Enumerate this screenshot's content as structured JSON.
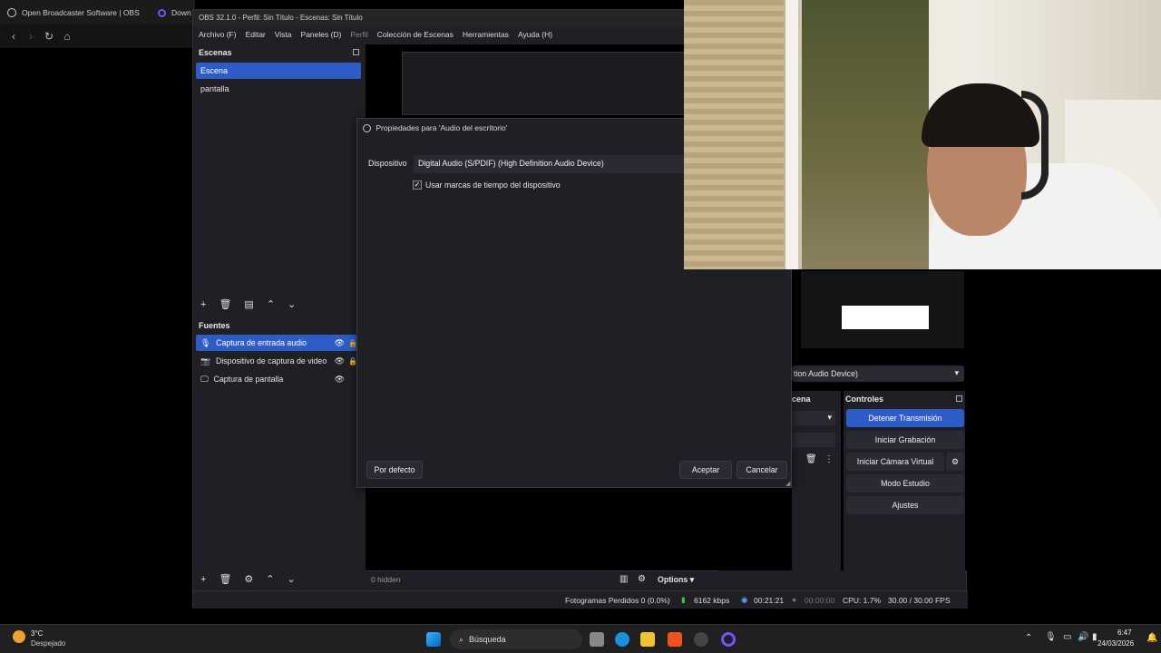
{
  "browser": {
    "tab1": "Open Broadcaster Software | OBS",
    "tab2": "Down"
  },
  "obs": {
    "title": "OBS 32.1.0 - Perfil: Sin Título - Escenas: Sin Título",
    "menu": [
      "Archivo (F)",
      "Editar",
      "Vista",
      "Paneles (D)",
      "Perfil",
      "Colección de Escenas",
      "Herramientas",
      "Ayuda (H)"
    ],
    "scenes_title": "Escenas",
    "scenes": [
      "Escena",
      "pantalla"
    ],
    "sources_title": "Fuentes",
    "sources": [
      "Captura de entrada audio",
      "Dispositivo de captura de video",
      "Captura de pantalla"
    ],
    "hidden_label": "0 hidden",
    "options_label": "Options",
    "device_partial": "tion Audio Device)",
    "scene_partial": "cena",
    "controls_title": "Controles",
    "controls": [
      "Detener Transmisión",
      "Iniciar Grabación",
      "Iniciar Cámara Virtual",
      "Modo Estudio",
      "Ajustes"
    ],
    "status": {
      "dropped": "Fotogramas Perdidos 0 (0.0%)",
      "bitrate": "6162 kbps",
      "stream_time": "00:21:21",
      "rec_time": "00:00:00",
      "cpu": "CPU: 1.7%",
      "fps": "30.00 / 30.00 FPS"
    }
  },
  "dialog": {
    "title": "Propiedades para 'Audio del escritorio'",
    "device_label": "Dispositivo",
    "device_value": "Digital Audio (S/PDIF) (High Definition Audio Device)",
    "checkbox_label": "Usar marcas de tiempo del dispositivo",
    "checkbox_checked": true,
    "default_button": "Por defecto",
    "accept_button": "Aceptar",
    "cancel_button": "Cancelar"
  },
  "taskbar": {
    "weather_temp": "3°C",
    "weather_desc": "Despejado",
    "search_placeholder": "Búsqueda",
    "time": "6:47",
    "date": "24/03/2026"
  },
  "colors": {
    "accent": "#2d5cc7",
    "panel": "#1f1f25",
    "background": "#000000"
  }
}
